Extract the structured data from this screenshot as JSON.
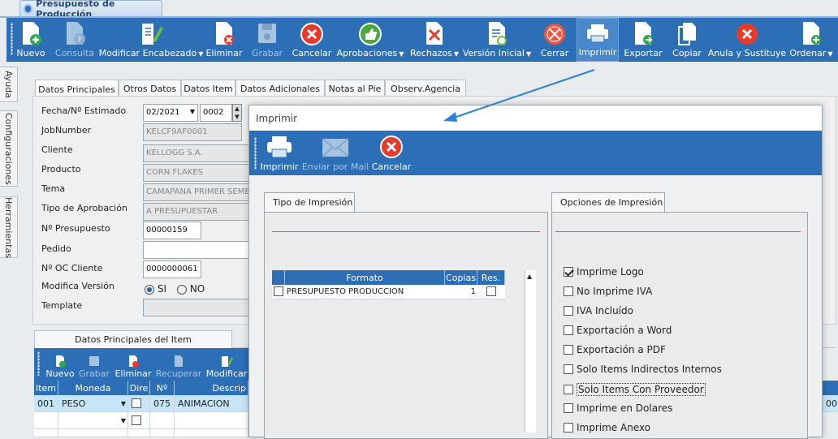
{
  "window": {
    "tab_title": "Presupuesto de Producción"
  },
  "toolbar": {
    "buttons": [
      {
        "label": "Nuevo",
        "icon": "document-plus-icon",
        "disabled": false,
        "dropdown": false
      },
      {
        "label": "Consulta",
        "icon": "document-question-icon",
        "disabled": true,
        "dropdown": false
      },
      {
        "label": "Modificar Encabezado",
        "icon": "document-edit-icon",
        "disabled": false,
        "dropdown": true
      },
      {
        "label": "Eliminar",
        "icon": "document-delete-icon",
        "disabled": false,
        "dropdown": false
      },
      {
        "label": "Grabar",
        "icon": "floppy-icon",
        "disabled": true,
        "dropdown": false
      },
      {
        "label": "Cancelar",
        "icon": "cancel-icon",
        "disabled": false,
        "dropdown": false
      },
      {
        "label": "Aprobaciones",
        "icon": "thumbs-up-icon",
        "disabled": false,
        "dropdown": true
      },
      {
        "label": "Rechazos",
        "icon": "document-reject-icon",
        "disabled": false,
        "dropdown": true
      },
      {
        "label": "Versión Inicial",
        "icon": "document-version-icon",
        "disabled": false,
        "dropdown": true
      },
      {
        "label": "Cerrar",
        "icon": "close-circle-icon",
        "disabled": false,
        "dropdown": false
      },
      {
        "label": "Imprimir",
        "icon": "printer-icon",
        "disabled": false,
        "dropdown": false,
        "active": true
      },
      {
        "label": "Exportar",
        "icon": "document-export-icon",
        "disabled": false,
        "dropdown": false
      },
      {
        "label": "Copiar",
        "icon": "copy-icon",
        "disabled": false,
        "dropdown": false
      },
      {
        "label": "Anula y Sustituye",
        "icon": "cancel-icon",
        "disabled": false,
        "dropdown": false
      },
      {
        "label": "Ordenar",
        "icon": "document-sort-icon",
        "disabled": false,
        "dropdown": true
      }
    ]
  },
  "side_tabs": [
    "Ayuda",
    "Configuraciones",
    "Herramientas"
  ],
  "form_tabs": [
    "Datos Principales",
    "Otros Datos",
    "Datos Item",
    "Datos Adicionales",
    "Notas al Pie",
    "Observ.Agencia"
  ],
  "form": {
    "labels": {
      "fecha": "Fecha/Nº Estimado",
      "jobnumber": "JobNumber",
      "cliente": "Cliente",
      "producto": "Producto",
      "tema": "Tema",
      "tipo_aprobacion": "Tipo de Aprobación",
      "presupuesto": "Nº Presupuesto",
      "pedido": "Pedido",
      "oc_cliente": "Nº OC Cliente",
      "modifica_version": "Modifica Versión",
      "template": "Template"
    },
    "values": {
      "fecha_mes": "02/2021",
      "estimado": "0002",
      "jobnumber": "KELCF9AF0001",
      "cliente": "KELLOGG S.A.",
      "producto": "CORN FLAKES",
      "tema": "CAMAPANA PRIMER SEMEST",
      "tipo_aprobacion": "A PRESUPUESTAR",
      "presupuesto": "00000159",
      "pedido": "",
      "oc_cliente": "0000000061",
      "template": ""
    },
    "radio": {
      "si": "SI",
      "no": "NO",
      "selected": "SI"
    }
  },
  "items": {
    "tab_label": "Datos Principales del Item",
    "toolbar": [
      {
        "label": "Nuevo",
        "icon": "document-plus-icon",
        "disabled": false
      },
      {
        "label": "Grabar",
        "icon": "floppy-icon",
        "disabled": true
      },
      {
        "label": "Eliminar",
        "icon": "document-delete-icon",
        "disabled": false
      },
      {
        "label": "Recuperar",
        "icon": "recover-icon",
        "disabled": true
      },
      {
        "label": "Modificar",
        "icon": "document-edit-icon",
        "disabled": false
      }
    ],
    "columns": [
      "Item",
      "Moneda",
      "Dire",
      "Nº",
      "Descrip"
    ],
    "rows": [
      {
        "item": "001",
        "moneda": "PESO",
        "dire": false,
        "num": "075",
        "descrip": "ANIMACION"
      },
      {
        "item": "",
        "moneda": "",
        "dire": false,
        "num": "",
        "descrip": ""
      },
      {
        "item": "",
        "moneda": "",
        "dire": false,
        "num": "",
        "descrip": ""
      }
    ],
    "right_edge_value": "00"
  },
  "dialog": {
    "title": "Imprimir",
    "buttons": [
      {
        "label": "Imprimir",
        "icon": "printer-icon",
        "disabled": false
      },
      {
        "label": "Enviar por Mail",
        "icon": "mail-icon",
        "disabled": true
      },
      {
        "label": "Cancelar",
        "icon": "cancel-icon",
        "disabled": false
      }
    ],
    "tipo_tab": "Tipo de Impresión",
    "opciones_tab": "Opciones de Impresión",
    "format_columns": [
      "Formato",
      "Copias",
      "Res."
    ],
    "format_rows": [
      {
        "formato": "PRESUPUESTO PRODUCCION",
        "copias": "1",
        "res": false,
        "selected": false
      }
    ],
    "options": [
      {
        "label": "Imprime Logo",
        "checked": true
      },
      {
        "label": "No Imprime IVA",
        "checked": false
      },
      {
        "label": "IVA Incluído",
        "checked": false
      },
      {
        "label": "Exportación a Word",
        "checked": false
      },
      {
        "label": "Exportación a PDF",
        "checked": false
      },
      {
        "label": "Solo Items Indirectos Internos",
        "checked": false
      },
      {
        "label": "Solo Items Con Proveedor",
        "checked": false,
        "focused": true
      },
      {
        "label": "Imprime en Dolares",
        "checked": false
      },
      {
        "label": "Imprime Anexo",
        "checked": false
      }
    ]
  },
  "colors": {
    "toolbar_blue": "#2d6fb6",
    "arrow_blue": "#2f7fd8",
    "selected_row": "#c6e6f7"
  }
}
